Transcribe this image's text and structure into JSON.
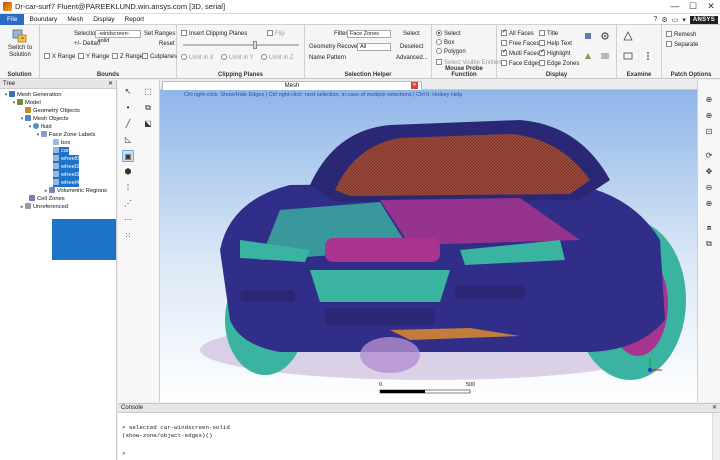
{
  "window": {
    "title": "Dr-car-surf7 Fluent@PAREEKLUND.win.ansys.com [3D, serial]",
    "controls": [
      "—",
      "☐",
      "✕"
    ]
  },
  "menu": {
    "items": [
      "File",
      "Boundary",
      "Mesh",
      "Display",
      "Report"
    ],
    "brand": "ANSYS"
  },
  "ribbon": {
    "solution": {
      "button": "Switch to Solution",
      "title": "Solution"
    },
    "bounds": {
      "selection_label": "Selection",
      "selection_value": "-windscreen-solid",
      "delta_label": "+/- Delta",
      "delta_value": "0",
      "set_ranges": "Set Ranges",
      "reset": "Reset",
      "x_range": "X Range",
      "y_range": "Y Range",
      "z_range": "Z Range",
      "cutplanes": "Cutplanes",
      "title": "Bounds"
    },
    "clipping": {
      "insert": "Insert Clipping Planes",
      "flip": "Flip",
      "limit_x": "Limit in X",
      "limit_y": "Limit in Y",
      "limit_z": "Limit in Z",
      "slider_position": 0.62,
      "title": "Clipping Planes"
    },
    "selection_helper": {
      "filter_label": "Filter",
      "filter_value": "Face Zones",
      "recovery_label": "Geometry Recovery",
      "recovery_value": "All",
      "pattern_label": "Name Pattern",
      "select": "Select",
      "deselect": "Deselect",
      "advanced": "Advanced...",
      "title": "Selection Helper"
    },
    "mouse_probe": {
      "select": "Select",
      "box": "Box",
      "polygon": "Polygon",
      "visible": "Select Visible Entities",
      "title": "Mouse Probe Function"
    },
    "display": {
      "all_faces": "All Faces",
      "free_faces": "Free Faces",
      "multi_faces": "Multi Faces",
      "face_edges": "Face Edges",
      "title_opt": "Title",
      "help_text": "Help Text",
      "highlight": "Highlight",
      "edge_zones": "Edge Zones",
      "title": "Display"
    },
    "examine": {
      "title": "Examine"
    },
    "patch": {
      "remesh": "Remesh",
      "separate": "Separate",
      "title": "Patch Options"
    }
  },
  "tree": {
    "header": "Tree",
    "nodes": {
      "mesh_generation": "Mesh Generation",
      "model": "Model",
      "geometry_objects": "Geometry Objects",
      "mesh_objects": "Mesh Objects",
      "fluid": "fluid",
      "face_zone_labels": "Face Zone Labels",
      "box": "box",
      "car": "car",
      "wheel0": "wheel0",
      "wheel2": "wheel2",
      "wheel3": "wheel3",
      "wheel4": "wheel4",
      "volumetric_regions": "Volumetric Regions",
      "cell_zones": "Cell Zones",
      "unreferenced": "Unreferenced"
    }
  },
  "graphics": {
    "tab_title": "Mesh",
    "hint": "Ctrl right-click: Show/Hide Edges | Ctrl right-click: next selection, in case of multiple selections | Ctrl h: Hotkey Help",
    "scale_min": "0",
    "scale_max": "500"
  },
  "console": {
    "title": "Console",
    "lines": [
      "> selected car-windscreen-solid",
      "(show-zone/object-edges)()",
      ">"
    ]
  },
  "colors": {
    "selection_blue": "#1e72c8",
    "car_body": "#2d2a7a",
    "car_teal": "#3ab3a1",
    "car_magenta": "#a8348f",
    "mesh_orange": "#b8553a"
  }
}
